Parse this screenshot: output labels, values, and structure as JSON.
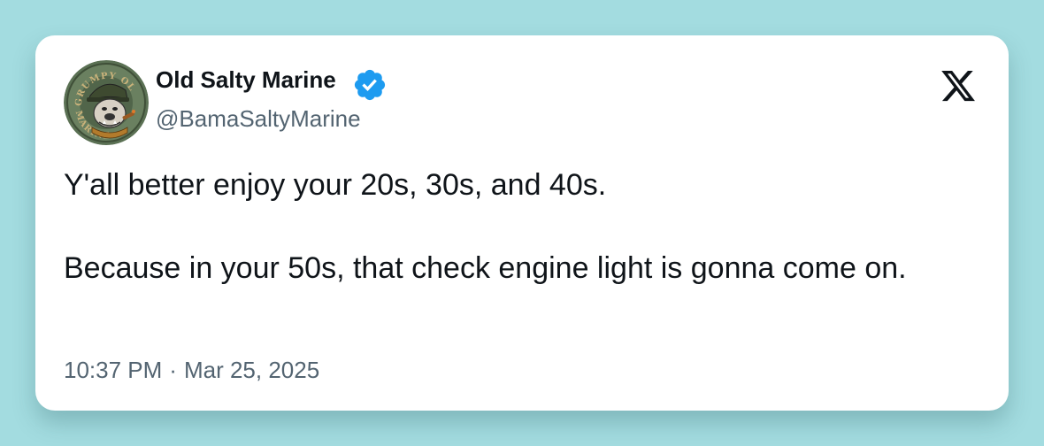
{
  "user": {
    "display_name": "Old Salty Marine",
    "handle": "@BamaSaltyMarine",
    "avatar_text_top": "GRUMPY OL",
    "avatar_text_bottom": "MARINE"
  },
  "tweet": {
    "line1": "Y'all better enjoy your 20s, 30s, and 40s.",
    "line2": "Because in your 50s, that check engine light is gonna come on.",
    "time": "10:37 PM",
    "separator": "·",
    "date": "Mar 25, 2025"
  },
  "icons": {
    "avatar": "bulldog-avatar",
    "badge": "verified-badge-icon",
    "logo": "x-logo-icon"
  },
  "colors": {
    "background": "#a3dce0",
    "verified": "#1d9bf0",
    "text": "#0f1419",
    "muted": "#536471"
  }
}
